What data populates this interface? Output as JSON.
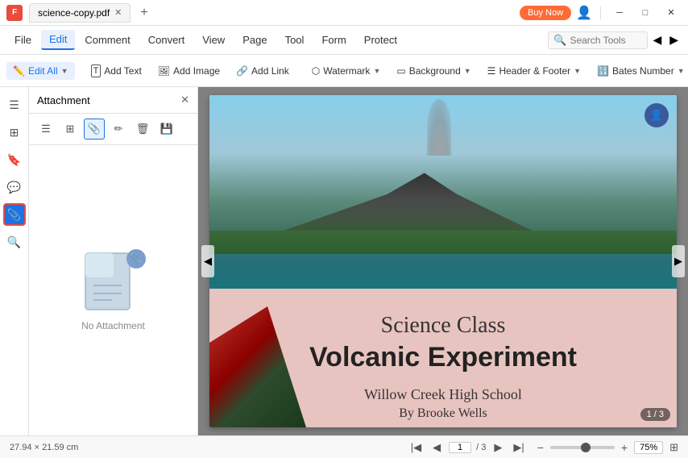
{
  "titlebar": {
    "app_icon": "F",
    "tab_title": "science-copy.pdf",
    "new_tab_label": "+",
    "buy_now_label": "Buy Now",
    "min_btn": "─",
    "max_btn": "□",
    "close_btn": "✕"
  },
  "menubar": {
    "file": "File",
    "edit": "Edit",
    "comment": "Comment",
    "convert": "Convert",
    "view": "View",
    "page": "Page",
    "tool": "Tool",
    "form": "Form",
    "protect": "Protect",
    "search_placeholder": "Search Tools"
  },
  "toolbar": {
    "edit_all": "Edit All",
    "add_text": "Add Text",
    "add_image": "Add Image",
    "add_link": "Add Link",
    "watermark": "Watermark",
    "background": "Background",
    "header_footer": "Header & Footer",
    "bates_number": "Bates Number"
  },
  "attachment_panel": {
    "title": "Attachment",
    "no_attachment": "No Attachment"
  },
  "pdf": {
    "title_line1": "Science Class",
    "title_line2": "Volcanic Experiment",
    "school": "Willow Creek High School",
    "author": "By Brooke Wells",
    "page_badge": "1 / 3"
  },
  "statusbar": {
    "dimensions": "27.94 × 21.59 cm",
    "page_current": "1",
    "page_total": "/ 3",
    "zoom_level": "75%"
  }
}
